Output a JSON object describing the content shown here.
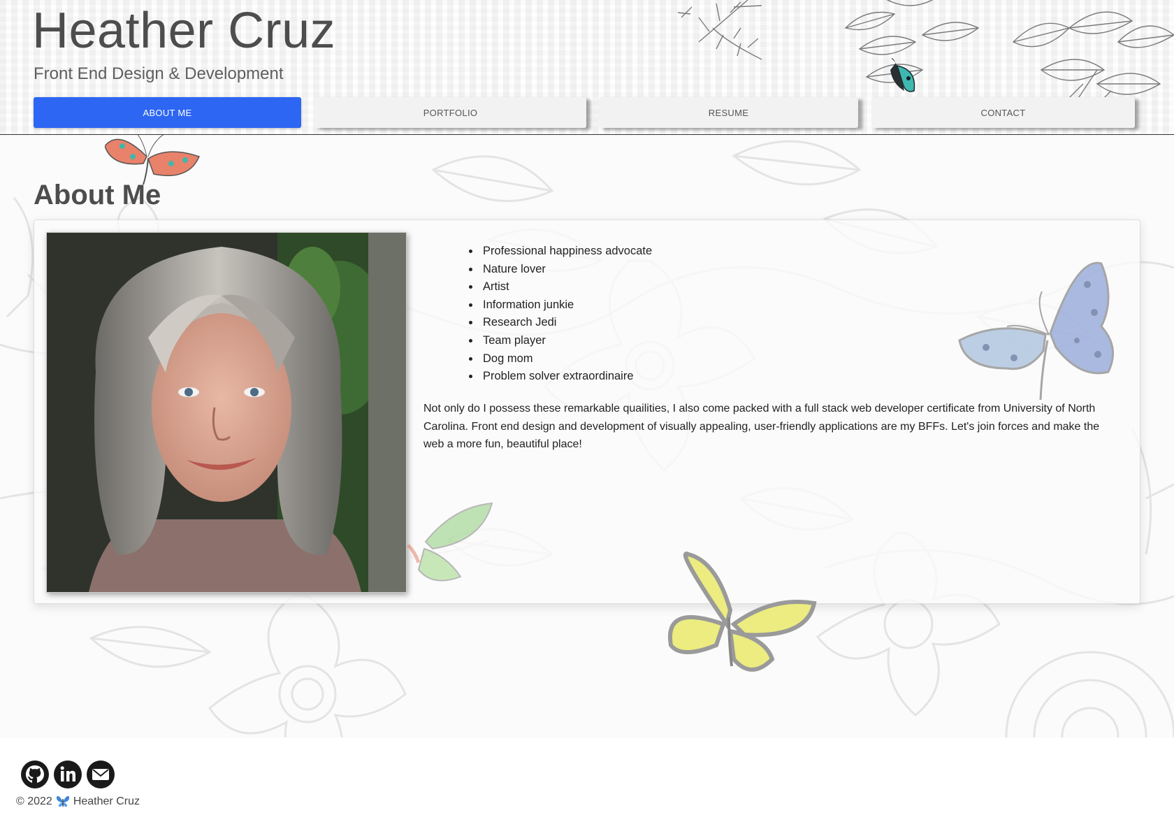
{
  "header": {
    "title": "Heather Cruz",
    "subtitle": "Front End Design & Development"
  },
  "nav": {
    "items": [
      {
        "label": "ABOUT ME",
        "active": true
      },
      {
        "label": "PORTFOLIO",
        "active": false
      },
      {
        "label": "RESUME",
        "active": false
      },
      {
        "label": "CONTACT",
        "active": false
      }
    ]
  },
  "about": {
    "heading": "About Me",
    "traits": [
      "Professional happiness advocate",
      "Nature lover",
      "Artist",
      "Information junkie",
      "Research Jedi",
      "Team player",
      "Dog mom",
      "Problem solver extraordinaire"
    ],
    "bio": "Not only do I possess these remarkable quailities, I also come packed with a full stack web developer certificate from University of North Carolina. Front end design and development of visually appealing, user-friendly applications are my BFFs. Let's join forces and make the web a more fun, beautiful place!"
  },
  "footer": {
    "social": [
      {
        "icon": "github-icon"
      },
      {
        "icon": "linkedin-icon"
      },
      {
        "icon": "email-icon"
      }
    ],
    "copyright_prefix": "© 2022",
    "copyright_name": "Heather Cruz"
  },
  "colors": {
    "accent": "#2c66f2",
    "heading": "#4d4d4d",
    "tab_bg": "#f2f2f2"
  }
}
